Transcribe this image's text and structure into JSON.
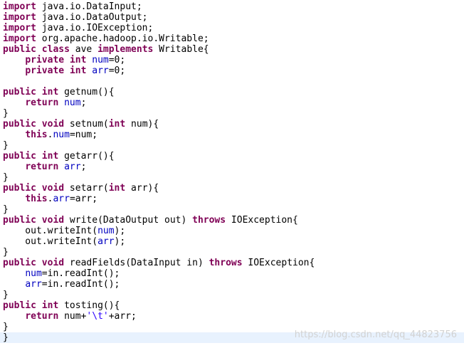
{
  "editor": {
    "lines": [
      [
        {
          "t": "import",
          "k": "kw"
        },
        {
          "t": " java.io.DataInput;",
          "k": "plain"
        }
      ],
      [
        {
          "t": "import",
          "k": "kw"
        },
        {
          "t": " java.io.DataOutput;",
          "k": "plain"
        }
      ],
      [
        {
          "t": "import",
          "k": "kw"
        },
        {
          "t": " java.io.IOException;",
          "k": "plain"
        }
      ],
      [
        {
          "t": "import",
          "k": "kw"
        },
        {
          "t": " org.apache.hadoop.io.Writable;",
          "k": "plain"
        }
      ],
      [
        {
          "t": "public",
          "k": "kw"
        },
        {
          "t": " ",
          "k": "plain"
        },
        {
          "t": "class",
          "k": "kw"
        },
        {
          "t": " ave ",
          "k": "plain"
        },
        {
          "t": "implements",
          "k": "kw"
        },
        {
          "t": " Writable{",
          "k": "plain"
        }
      ],
      [
        {
          "t": "    ",
          "k": "plain"
        },
        {
          "t": "private",
          "k": "kw"
        },
        {
          "t": " ",
          "k": "plain"
        },
        {
          "t": "int",
          "k": "kw"
        },
        {
          "t": " ",
          "k": "plain"
        },
        {
          "t": "num",
          "k": "fld"
        },
        {
          "t": "=0;",
          "k": "plain"
        }
      ],
      [
        {
          "t": "    ",
          "k": "plain"
        },
        {
          "t": "private",
          "k": "kw"
        },
        {
          "t": " ",
          "k": "plain"
        },
        {
          "t": "int",
          "k": "kw"
        },
        {
          "t": " ",
          "k": "plain"
        },
        {
          "t": "arr",
          "k": "fld"
        },
        {
          "t": "=0;",
          "k": "plain"
        }
      ],
      [],
      [
        {
          "t": "public",
          "k": "kw"
        },
        {
          "t": " ",
          "k": "plain"
        },
        {
          "t": "int",
          "k": "kw"
        },
        {
          "t": " getnum(){",
          "k": "plain"
        }
      ],
      [
        {
          "t": "    ",
          "k": "plain"
        },
        {
          "t": "return",
          "k": "kw"
        },
        {
          "t": " ",
          "k": "plain"
        },
        {
          "t": "num",
          "k": "fld"
        },
        {
          "t": ";",
          "k": "plain"
        }
      ],
      [
        {
          "t": "}",
          "k": "plain"
        }
      ],
      [
        {
          "t": "public",
          "k": "kw"
        },
        {
          "t": " ",
          "k": "plain"
        },
        {
          "t": "void",
          "k": "kw"
        },
        {
          "t": " setnum(",
          "k": "plain"
        },
        {
          "t": "int",
          "k": "kw"
        },
        {
          "t": " num){",
          "k": "plain"
        }
      ],
      [
        {
          "t": "    ",
          "k": "plain"
        },
        {
          "t": "this",
          "k": "kw"
        },
        {
          "t": ".",
          "k": "plain"
        },
        {
          "t": "num",
          "k": "fld"
        },
        {
          "t": "=num;",
          "k": "plain"
        }
      ],
      [
        {
          "t": "}",
          "k": "plain"
        }
      ],
      [
        {
          "t": "public",
          "k": "kw"
        },
        {
          "t": " ",
          "k": "plain"
        },
        {
          "t": "int",
          "k": "kw"
        },
        {
          "t": " getarr(){",
          "k": "plain"
        }
      ],
      [
        {
          "t": "    ",
          "k": "plain"
        },
        {
          "t": "return",
          "k": "kw"
        },
        {
          "t": " ",
          "k": "plain"
        },
        {
          "t": "arr",
          "k": "fld"
        },
        {
          "t": ";",
          "k": "plain"
        }
      ],
      [
        {
          "t": "}",
          "k": "plain"
        }
      ],
      [
        {
          "t": "public",
          "k": "kw"
        },
        {
          "t": " ",
          "k": "plain"
        },
        {
          "t": "void",
          "k": "kw"
        },
        {
          "t": " setarr(",
          "k": "plain"
        },
        {
          "t": "int",
          "k": "kw"
        },
        {
          "t": " arr){",
          "k": "plain"
        }
      ],
      [
        {
          "t": "    ",
          "k": "plain"
        },
        {
          "t": "this",
          "k": "kw"
        },
        {
          "t": ".",
          "k": "plain"
        },
        {
          "t": "arr",
          "k": "fld"
        },
        {
          "t": "=arr;",
          "k": "plain"
        }
      ],
      [
        {
          "t": "}",
          "k": "plain"
        }
      ],
      [
        {
          "t": "public",
          "k": "kw"
        },
        {
          "t": " ",
          "k": "plain"
        },
        {
          "t": "void",
          "k": "kw"
        },
        {
          "t": " write(DataOutput out) ",
          "k": "plain"
        },
        {
          "t": "throws",
          "k": "kw"
        },
        {
          "t": " IOException{",
          "k": "plain"
        }
      ],
      [
        {
          "t": "    out.writeInt(",
          "k": "plain"
        },
        {
          "t": "num",
          "k": "fld"
        },
        {
          "t": ");",
          "k": "plain"
        }
      ],
      [
        {
          "t": "    out.writeInt(",
          "k": "plain"
        },
        {
          "t": "arr",
          "k": "fld"
        },
        {
          "t": ");",
          "k": "plain"
        }
      ],
      [
        {
          "t": "}",
          "k": "plain"
        }
      ],
      [
        {
          "t": "public",
          "k": "kw"
        },
        {
          "t": " ",
          "k": "plain"
        },
        {
          "t": "void",
          "k": "kw"
        },
        {
          "t": " readFields(DataInput in) ",
          "k": "plain"
        },
        {
          "t": "throws",
          "k": "kw"
        },
        {
          "t": " IOException{",
          "k": "plain"
        }
      ],
      [
        {
          "t": "    ",
          "k": "plain"
        },
        {
          "t": "num",
          "k": "fld"
        },
        {
          "t": "=in.readInt();",
          "k": "plain"
        }
      ],
      [
        {
          "t": "    ",
          "k": "plain"
        },
        {
          "t": "arr",
          "k": "fld"
        },
        {
          "t": "=in.readInt();",
          "k": "plain"
        }
      ],
      [
        {
          "t": "}",
          "k": "plain"
        }
      ],
      [
        {
          "t": "public",
          "k": "kw"
        },
        {
          "t": " ",
          "k": "plain"
        },
        {
          "t": "int",
          "k": "kw"
        },
        {
          "t": " tosting(){",
          "k": "plain"
        }
      ],
      [
        {
          "t": "    ",
          "k": "plain"
        },
        {
          "t": "return",
          "k": "kw"
        },
        {
          "t": " num+",
          "k": "plain"
        },
        {
          "t": "'\\t'",
          "k": "str"
        },
        {
          "t": "+arr;",
          "k": "plain"
        }
      ],
      [
        {
          "t": "}",
          "k": "plain"
        }
      ],
      [
        {
          "t": "}",
          "k": "plain"
        }
      ]
    ]
  },
  "watermark": "https://blog.csdn.net/qq_44823756",
  "colors": {
    "keyword": "#7f0055",
    "field": "#0000c0",
    "string": "#2a00ff",
    "text": "#000000",
    "current_line": "#e8f2fe",
    "background": "#ffffff"
  }
}
